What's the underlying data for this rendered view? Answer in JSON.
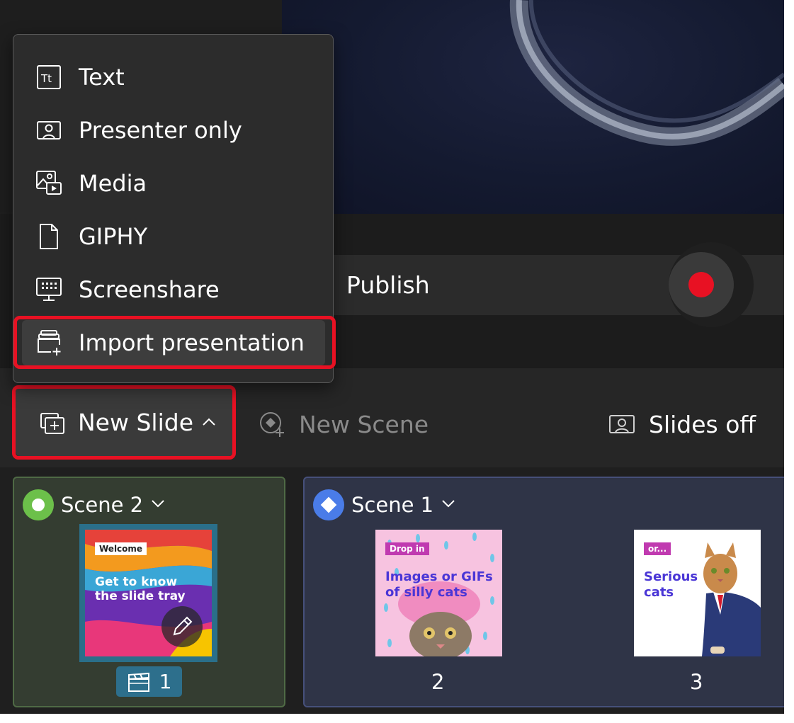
{
  "menu": {
    "items": [
      {
        "label": "Text",
        "icon": "text-icon"
      },
      {
        "label": "Presenter only",
        "icon": "presenter-icon"
      },
      {
        "label": "Media",
        "icon": "media-icon"
      },
      {
        "label": "GIPHY",
        "icon": "document-icon"
      },
      {
        "label": "Screenshare",
        "icon": "screenshare-icon"
      },
      {
        "label": "Import presentation",
        "icon": "import-presentation-icon"
      }
    ]
  },
  "controls": {
    "publish_label": "Publish",
    "record_color": "#e81123"
  },
  "toolbar": {
    "new_slide_label": "New Slide",
    "new_scene_label": "New Scene",
    "slides_off_label": "Slides off"
  },
  "scenes": [
    {
      "name": "Scene 2",
      "indicator_color": "#6cc04a",
      "slides": [
        {
          "number": "1",
          "tag": "Welcome",
          "text": "Get to know the slide tray"
        }
      ]
    },
    {
      "name": "Scene 1",
      "indicator_color": "#4a7ce8",
      "slides": [
        {
          "number": "2",
          "tag": "Drop in",
          "text": "Images or GIFs of silly cats"
        },
        {
          "number": "3",
          "tag": "or...",
          "text": "Serious cats"
        }
      ]
    }
  ],
  "highlight_color": "#e81123"
}
